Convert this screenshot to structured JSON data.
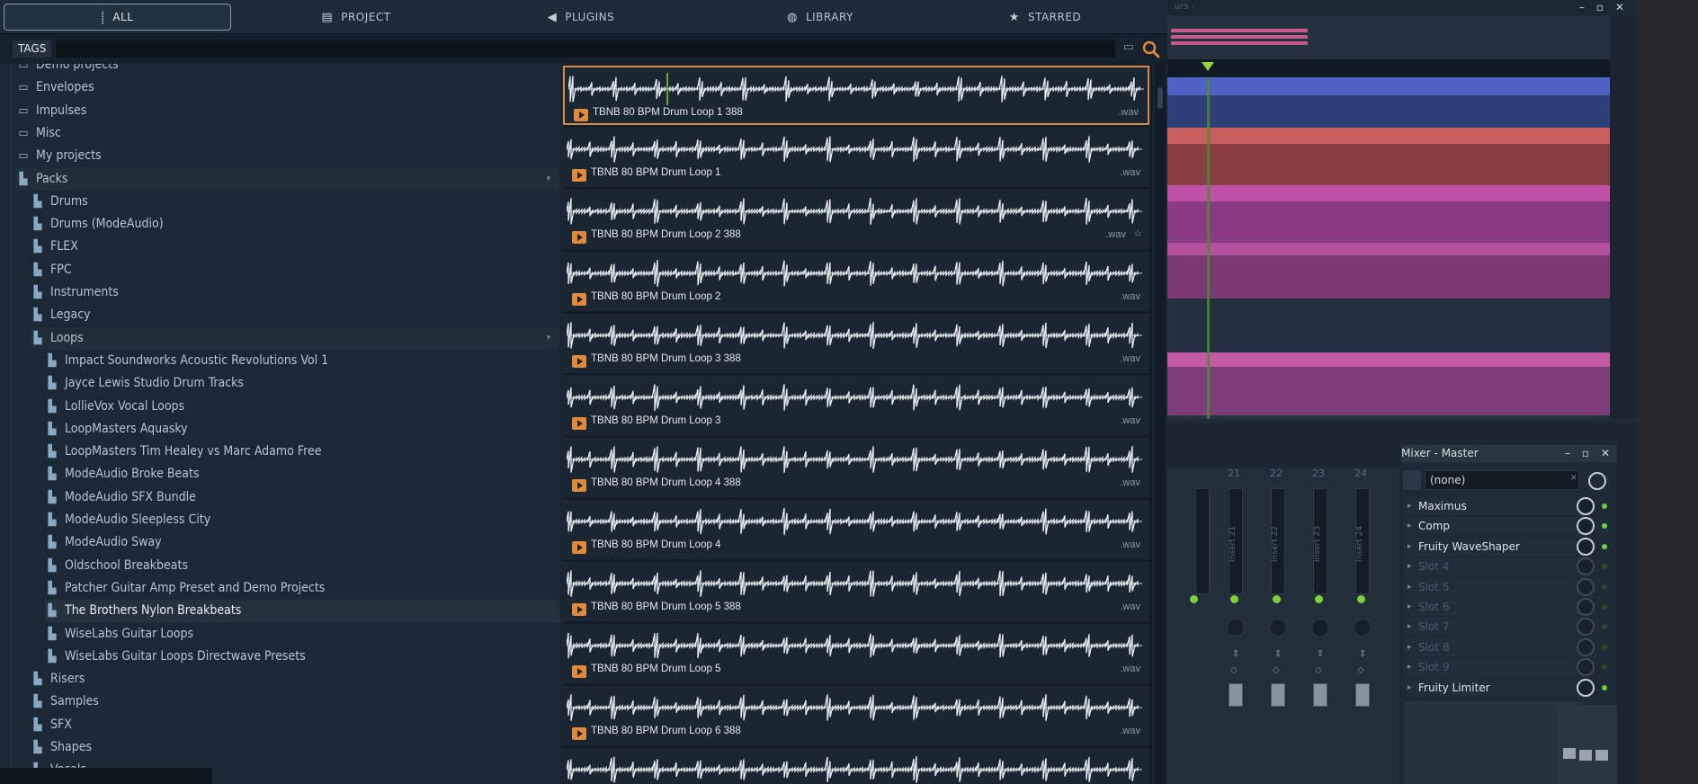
{
  "tabs": [
    {
      "label": "ALL",
      "icon": "waveform-icon"
    },
    {
      "label": "PROJECT",
      "icon": "document-icon"
    },
    {
      "label": "PLUGINS",
      "icon": "plug-icon"
    },
    {
      "label": "LIBRARY",
      "icon": "globe-icon"
    },
    {
      "label": "STARRED",
      "icon": "star-icon"
    }
  ],
  "tags_label": "TAGS",
  "tree": [
    {
      "label": "Demo projects"
    },
    {
      "label": "Envelopes"
    },
    {
      "label": "Impulses"
    },
    {
      "label": "Misc"
    },
    {
      "label": "My projects"
    },
    {
      "label": "Packs"
    },
    {
      "label": "Drums"
    },
    {
      "label": "Drums (ModeAudio)"
    },
    {
      "label": "FLEX"
    },
    {
      "label": "FPC"
    },
    {
      "label": "Instruments"
    },
    {
      "label": "Legacy"
    },
    {
      "label": "Loops"
    },
    {
      "label": "Impact Soundworks Acoustic Revolutions Vol 1"
    },
    {
      "label": "Jayce Lewis Studio Drum Tracks"
    },
    {
      "label": "LollieVox Vocal Loops"
    },
    {
      "label": "LoopMasters Aquasky"
    },
    {
      "label": "LoopMasters Tim Healey vs Marc Adamo Free"
    },
    {
      "label": "ModeAudio Broke Beats"
    },
    {
      "label": "ModeAudio SFX Bundle"
    },
    {
      "label": "ModeAudio Sleepless City"
    },
    {
      "label": "ModeAudio Sway"
    },
    {
      "label": "Oldschool Breakbeats"
    },
    {
      "label": "Patcher Guitar Amp Preset and Demo Projects"
    },
    {
      "label": "The Brothers Nylon Breakbeats"
    },
    {
      "label": "WiseLabs Guitar Loops"
    },
    {
      "label": "WiseLabs Guitar Loops Directwave Presets"
    },
    {
      "label": "Risers"
    },
    {
      "label": "Samples"
    },
    {
      "label": "SFX"
    },
    {
      "label": "Shapes"
    },
    {
      "label": "Vocals"
    }
  ],
  "samples": [
    {
      "name": "TBNB 80 BPM Drum Loop 1 388",
      "ext": ".wav"
    },
    {
      "name": "TBNB 80 BPM Drum Loop 1",
      "ext": ".wav"
    },
    {
      "name": "TBNB 80 BPM Drum Loop 2 388",
      "ext": ".wav"
    },
    {
      "name": "TBNB 80 BPM Drum Loop 2",
      "ext": ".wav"
    },
    {
      "name": "TBNB 80 BPM Drum Loop 3 388",
      "ext": ".wav"
    },
    {
      "name": "TBNB 80 BPM Drum Loop 3",
      "ext": ".wav"
    },
    {
      "name": "TBNB 80 BPM Drum Loop 4 388",
      "ext": ".wav"
    },
    {
      "name": "TBNB 80 BPM Drum Loop 4",
      "ext": ".wav"
    },
    {
      "name": "TBNB 80 BPM Drum Loop 5 388",
      "ext": ".wav"
    },
    {
      "name": "TBNB 80 BPM Drum Loop 5",
      "ext": ".wav"
    },
    {
      "name": "TBNB 80 BPM Drum Loop 6 388",
      "ext": ".wav"
    },
    {
      "name": "",
      "ext": ""
    }
  ],
  "mixer": {
    "title": "Mixer - Master",
    "preset": "(none)",
    "insert_numbers": [
      "21",
      "22",
      "23",
      "24"
    ],
    "insert_labels": [
      "Insert 21",
      "Insert 22",
      "Insert 23",
      "Insert 24"
    ],
    "slots": [
      {
        "label": "Maximus",
        "active": true
      },
      {
        "label": "Comp",
        "active": true
      },
      {
        "label": "Fruity WaveShaper",
        "active": true
      },
      {
        "label": "Slot 4",
        "active": false
      },
      {
        "label": "Slot 5",
        "active": false
      },
      {
        "label": "Slot 6",
        "active": false
      },
      {
        "label": "Slot 7",
        "active": false
      },
      {
        "label": "Slot 8",
        "active": false
      },
      {
        "label": "Slot 9",
        "active": false
      },
      {
        "label": "Fruity Limiter",
        "active": true
      }
    ]
  },
  "playlist": {
    "title": "urs ›"
  },
  "colors": {
    "accent": "#e08a3e",
    "waveform": "#e9eef2",
    "led": "#7fcf3c"
  }
}
